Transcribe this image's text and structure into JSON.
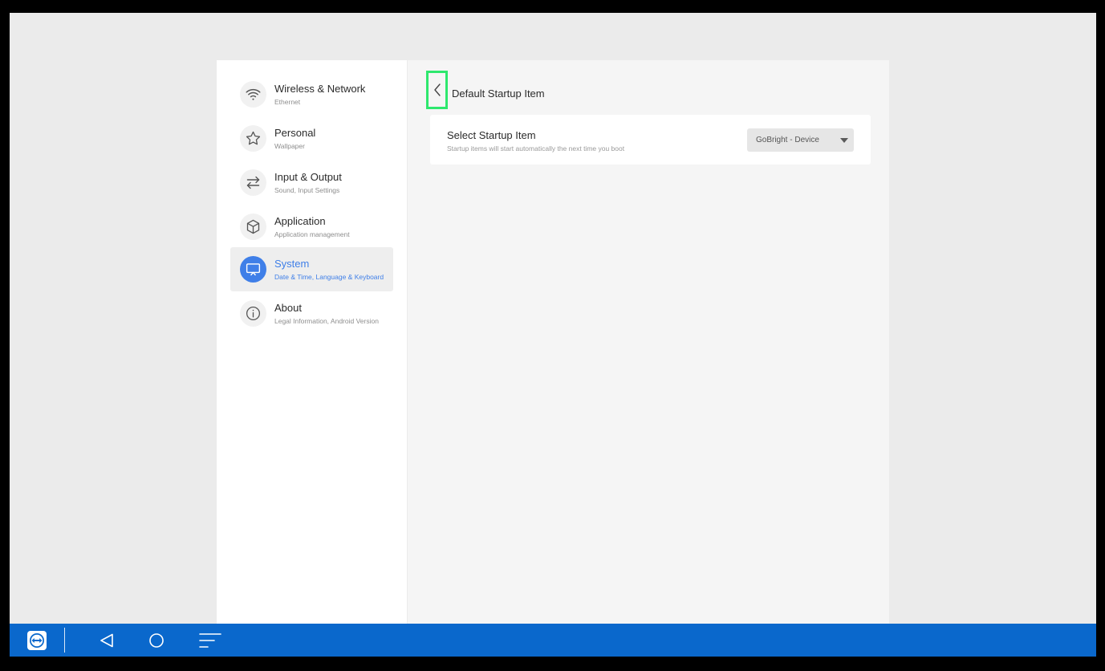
{
  "sidebar": {
    "items": [
      {
        "title": "Wireless & Network",
        "subtitle": "Ethernet",
        "icon": "wifi-icon",
        "active": false
      },
      {
        "title": "Personal",
        "subtitle": "Wallpaper",
        "icon": "star-icon",
        "active": false
      },
      {
        "title": "Input & Output",
        "subtitle": "Sound, Input Settings",
        "icon": "swap-arrows-icon",
        "active": false
      },
      {
        "title": "Application",
        "subtitle": "Application management",
        "icon": "cube-icon",
        "active": false
      },
      {
        "title": "System",
        "subtitle": "Date & Time, Language & Keyboard",
        "icon": "monitor-icon",
        "active": true
      },
      {
        "title": "About",
        "subtitle": "Legal Information, Android Version",
        "icon": "info-icon",
        "active": false
      }
    ]
  },
  "page": {
    "title": "Default Startup Item"
  },
  "startup": {
    "title": "Select Startup Item",
    "subtitle": "Startup items will start automatically the next time you boot",
    "selected": "GoBright - Device"
  },
  "colors": {
    "accent": "#3f7fe8",
    "taskbar": "#0a68cc",
    "highlight": "#2ee86e"
  },
  "taskbar": {
    "buttons": [
      "teamviewer-icon",
      "back-triangle-icon",
      "home-circle-icon",
      "menu-lines-icon"
    ]
  }
}
